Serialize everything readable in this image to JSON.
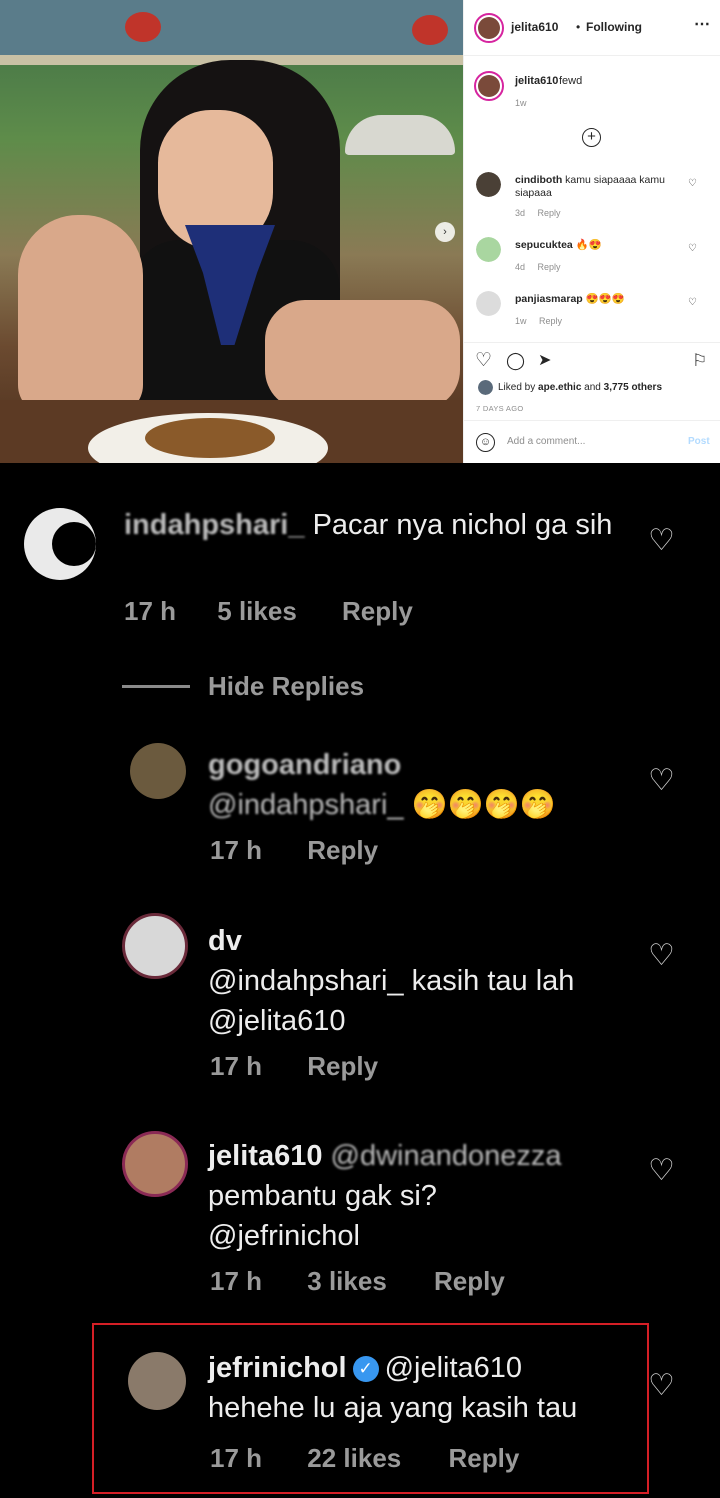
{
  "post": {
    "header": {
      "username": "jelita610",
      "separator": "•",
      "follow_label": "Following",
      "more_icon": "⋯"
    },
    "caption": {
      "username": "jelita610",
      "text": "fewd",
      "time": "1w"
    },
    "load_more_icon": "+",
    "next_icon": "›",
    "comments": [
      {
        "username": "cindiboth",
        "text": "kamu siapaaaa kamu siapaaa",
        "time": "3d",
        "reply": "Reply"
      },
      {
        "username": "sepucuktea",
        "text": "🔥😍",
        "time": "4d",
        "reply": "Reply"
      },
      {
        "username": "panjiasmarap",
        "text": "😍😍😍",
        "time": "1w",
        "reply": "Reply"
      }
    ],
    "actions": {
      "like_icon": "♡",
      "comment_icon": "◯",
      "share_icon": "➤",
      "save_icon": "⚐"
    },
    "likes": {
      "prefix": "Liked by",
      "user": "ape.ethic",
      "and": "and",
      "others": "3,775 others"
    },
    "date": "7 DAYS AGO",
    "add_comment": {
      "placeholder": "Add a comment...",
      "post_label": "Post",
      "emoji_icon": "☺"
    }
  },
  "thread": {
    "comment_main": {
      "username": "indahpshari_",
      "text": "Pacar nya nichol ga sih",
      "time": "17 h",
      "likes": "5 likes",
      "reply": "Reply"
    },
    "hide_replies": "Hide Replies",
    "replies": [
      {
        "username": "gogoandriano",
        "mention": "@indahpshari_",
        "text": "🤭🤭🤭🤭",
        "time": "17 h",
        "likes": "",
        "reply": "Reply"
      },
      {
        "username": "dv",
        "mention": "@indahpshari_",
        "text": "kasih tau lah",
        "mention2": "@jelita610",
        "time": "17 h",
        "likes": "",
        "reply": "Reply"
      },
      {
        "username": "jelita610",
        "mention": "@dwinandonezza",
        "text": "pembantu gak si?",
        "mention2": "@jefrinichol",
        "time": "17 h",
        "likes": "3 likes",
        "reply": "Reply"
      },
      {
        "username": "jefrinichol",
        "verified": "✓",
        "mention": "@jelita610",
        "text": "hehehe lu aja yang kasih tau",
        "time": "17 h",
        "likes": "22 likes",
        "reply": "Reply"
      }
    ],
    "heart_icon": "♡"
  },
  "colors": {
    "instagram_text": "#262626",
    "secondary": "#8e8e8e",
    "verified": "#3897f0",
    "highlight_border": "#d51f26"
  }
}
